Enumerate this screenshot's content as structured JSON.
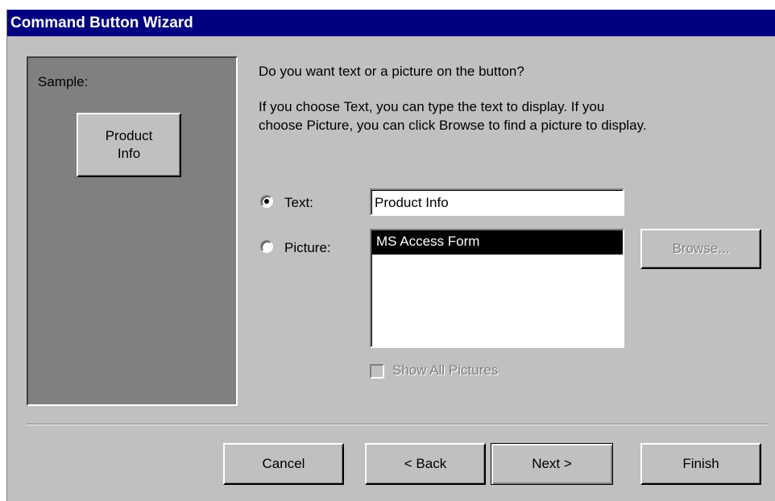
{
  "window": {
    "title": "Command Button Wizard"
  },
  "sample": {
    "label": "Sample:",
    "button_text": "Product Info"
  },
  "question": "Do you want text or a picture on the button?",
  "instructions": {
    "line1": "If you choose Text, you can type the text to display.  If you",
    "line2": "choose Picture, you can click Browse to find a picture to display."
  },
  "options": {
    "text_label": "Text:",
    "text_value": "Product Info",
    "text_selected": true,
    "picture_label": "Picture:",
    "picture_items": [
      "MS Access Form"
    ],
    "picture_selected_item": "MS Access Form",
    "browse_label": "Browse...",
    "show_all_label": "Show All Pictures"
  },
  "buttons": {
    "cancel": "Cancel",
    "back": "< Back",
    "next": "Next >",
    "finish": "Finish"
  },
  "colors": {
    "title_bar": "#000080",
    "face": "#c0c0c0",
    "sample_panel": "#808080"
  }
}
